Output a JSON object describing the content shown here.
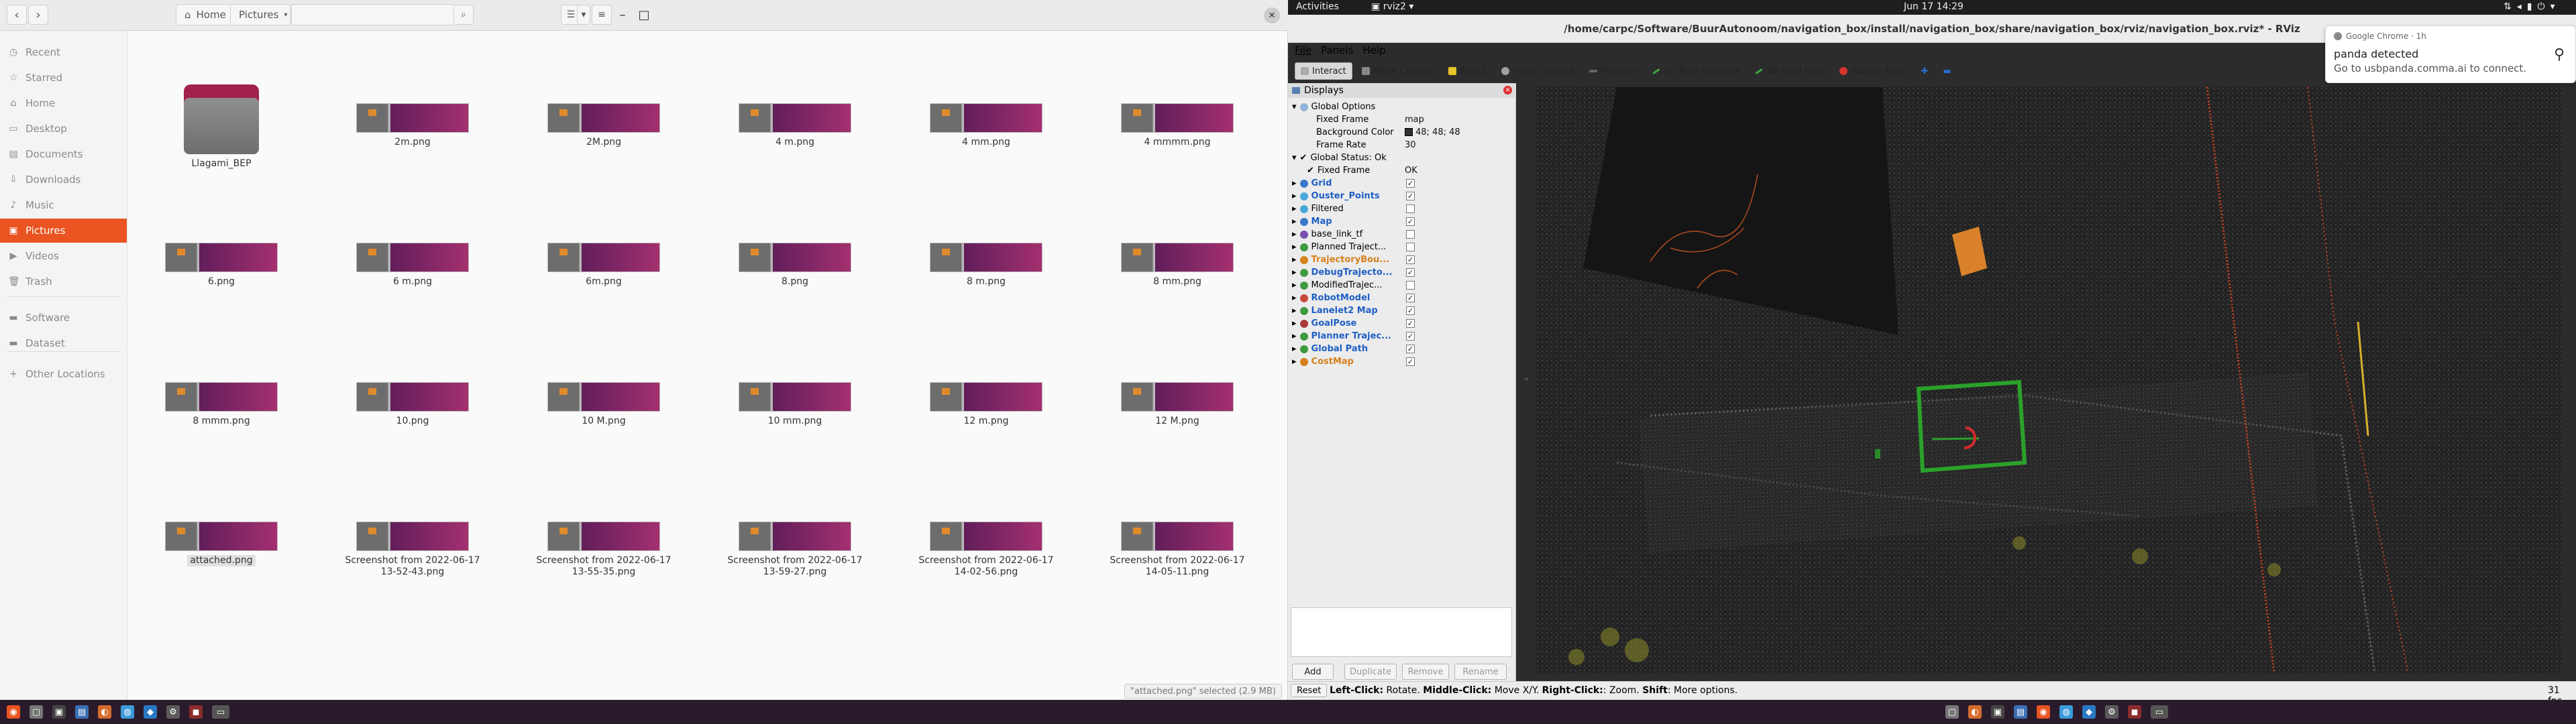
{
  "file_manager": {
    "breadcrumb": {
      "home": "Home",
      "current": "Pictures"
    },
    "sidebar": [
      {
        "label": "Recent",
        "icon": "clock-icon"
      },
      {
        "label": "Starred",
        "icon": "star-icon"
      },
      {
        "label": "Home",
        "icon": "home-icon"
      },
      {
        "label": "Desktop",
        "icon": "desktop-icon"
      },
      {
        "label": "Documents",
        "icon": "document-icon"
      },
      {
        "label": "Downloads",
        "icon": "download-icon"
      },
      {
        "label": "Music",
        "icon": "music-icon"
      },
      {
        "label": "Pictures",
        "icon": "picture-icon",
        "active": true
      },
      {
        "label": "Videos",
        "icon": "video-icon"
      },
      {
        "label": "Trash",
        "icon": "trash-icon"
      },
      {
        "label": "Software",
        "icon": "drive-icon"
      },
      {
        "label": "Dataset",
        "icon": "drive-icon"
      },
      {
        "label": "Other Locations",
        "icon": "plus-icon"
      }
    ],
    "files": [
      "Llagami_BEP",
      "2m.png",
      "2M.png",
      "4 m.png",
      "4 mm.png",
      "4 mmmm.png",
      "6.png",
      "6 m.png",
      "6m.png",
      "8.png",
      "8 m.png",
      "8 mm.png",
      "8 mmm.png",
      "10.png",
      "10 M.png",
      "10 mm.png",
      "12 m.png",
      "12 M.png",
      "attached.png",
      "Screenshot from 2022-06-17 13-52-43.png",
      "Screenshot from 2022-06-17 13-55-35.png",
      "Screenshot from 2022-06-17 13-59-27.png",
      "Screenshot from 2022-06-17 14-02-56.png",
      "Screenshot from 2022-06-17 14-05-11.png"
    ],
    "status": "\"attached.png\" selected (2.9 MB)"
  },
  "topbar": {
    "activities": "Activities",
    "app": "rviz2",
    "datetime": "Jun 17  14:29"
  },
  "rviz": {
    "title": "/home/carpc/Software/BuurAutonoom/navigation_box/install/navigation_box/share/navigation_box/rviz/navigation_box.rviz* - RViz",
    "menu": [
      "File",
      "Panels",
      "Help"
    ],
    "tools": [
      "Interact",
      "Move Camera",
      "Select",
      "Focus Camera",
      "Measure",
      "2D Pose Estimate",
      "2D Goal Pose",
      "Publish Point"
    ],
    "panel_title": "Displays",
    "global_options": {
      "label": "Global Options",
      "fixed_frame_label": "Fixed Frame",
      "fixed_frame_value": "map",
      "bg_color_label": "Background Color",
      "bg_color_value": "48; 48; 48",
      "frame_rate_label": "Frame Rate",
      "frame_rate_value": "30",
      "status_label": "Global Status: Ok",
      "status_fixed_label": "Fixed Frame",
      "status_fixed_value": "OK"
    },
    "displays": [
      {
        "name": "Grid",
        "checked": true,
        "style": "blue",
        "color": "#3a78c9"
      },
      {
        "name": "Ouster_Points",
        "checked": true,
        "style": "blue",
        "color": "#49a8d8"
      },
      {
        "name": "Filtered",
        "checked": false,
        "style": "plain",
        "color": "#49a8d8"
      },
      {
        "name": "Map",
        "checked": true,
        "style": "blue",
        "color": "#3a78c9"
      },
      {
        "name": "base_link_tf",
        "checked": false,
        "style": "plain",
        "color": "#7a4fb0"
      },
      {
        "name": "Planned Traject...",
        "checked": false,
        "style": "plain",
        "color": "#3f9a3f"
      },
      {
        "name": "TrajectoryBou...",
        "checked": true,
        "style": "orange",
        "color": "#d6801e"
      },
      {
        "name": "DebugTrajecto...",
        "checked": true,
        "style": "blue",
        "color": "#3f9a3f"
      },
      {
        "name": "ModifiedTrajec...",
        "checked": false,
        "style": "plain",
        "color": "#3f9a3f"
      },
      {
        "name": "RobotModel",
        "checked": true,
        "style": "blue",
        "color": "#c84a3a"
      },
      {
        "name": "Lanelet2 Map",
        "checked": true,
        "style": "blue",
        "color": "#3f9a3f"
      },
      {
        "name": "GoalPose",
        "checked": true,
        "style": "blue",
        "color": "#a93a3a"
      },
      {
        "name": "Planner Trajec...",
        "checked": true,
        "style": "blue",
        "color": "#3f9a3f"
      },
      {
        "name": "Global Path",
        "checked": true,
        "style": "blue",
        "color": "#3f9a3f"
      },
      {
        "name": "CostMap",
        "checked": true,
        "style": "orange",
        "color": "#d6801e"
      }
    ],
    "buttons": [
      "Add",
      "Duplicate",
      "Remove",
      "Rename"
    ],
    "reset": "Reset",
    "status_hint_bold1": "Left-Click:",
    "status_hint1": " Rotate. ",
    "status_hint_bold2": "Middle-Click:",
    "status_hint2": " Move X/Y. ",
    "status_hint_bold3": "Right-Click:",
    "status_hint3": ": Zoom. ",
    "status_hint_bold4": "Shift",
    "status_hint4": ": More options.",
    "fps": "31 fps"
  },
  "notification": {
    "app": "Google Chrome · 1h",
    "title": "panda detected",
    "body": "Go to usbpanda.comma.ai to connect."
  }
}
